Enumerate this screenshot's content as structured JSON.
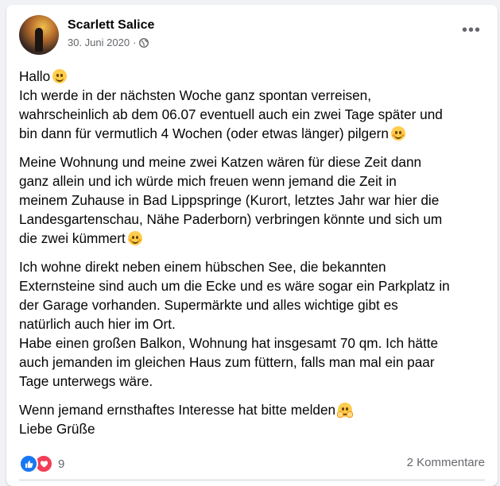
{
  "post": {
    "author": "Scarlett Salice",
    "date": "30. Juni 2020",
    "separator": "·",
    "privacy_icon": "globe-icon",
    "menu_icon": "more-icon",
    "menu_glyph": "•••"
  },
  "content": {
    "p1": [
      "Hallo",
      "Ich werde in der nächsten Woche ganz spontan verreisen,",
      "wahrscheinlich ab dem 06.07 eventuell auch ein zwei Tage später und",
      "bin dann für vermutlich 4 Wochen (oder etwas länger) pilgern"
    ],
    "p2": [
      "Meine Wohnung und meine zwei Katzen wären für diese Zeit dann",
      "ganz allein und ich würde mich freuen wenn jemand die Zeit in",
      "meinem Zuhause in Bad Lippspringe (Kurort, letztes Jahr war hier die",
      "Landesgartenschau, Nähe Paderborn) verbringen könnte und sich um",
      "die zwei kümmert"
    ],
    "p3": [
      "Ich wohne direkt neben einem hübschen See, die bekannten",
      "Externsteine sind auch um die Ecke und es wäre sogar ein Parkplatz in",
      "der Garage vorhanden. Supermärkte und alles wichtige gibt es",
      "natürlich auch hier im Ort.",
      "Habe einen großen Balkon, Wohnung hat insgesamt 70 qm. Ich hätte",
      "auch jemanden im gleichen Haus zum füttern, falls man mal ein paar",
      "Tage unterwegs wäre."
    ],
    "p4": [
      "Wenn jemand ernsthaftes Interesse hat bitte melden",
      "Liebe Grüße"
    ]
  },
  "footer": {
    "reaction_count": "9",
    "reaction_icons": [
      "like-icon",
      "love-icon"
    ],
    "comments_label": "2 Kommentare"
  },
  "colors": {
    "like": "#1877f2",
    "love": "#f33e58",
    "secondary_text": "#65676b",
    "emoji": "#ffcc4d"
  }
}
